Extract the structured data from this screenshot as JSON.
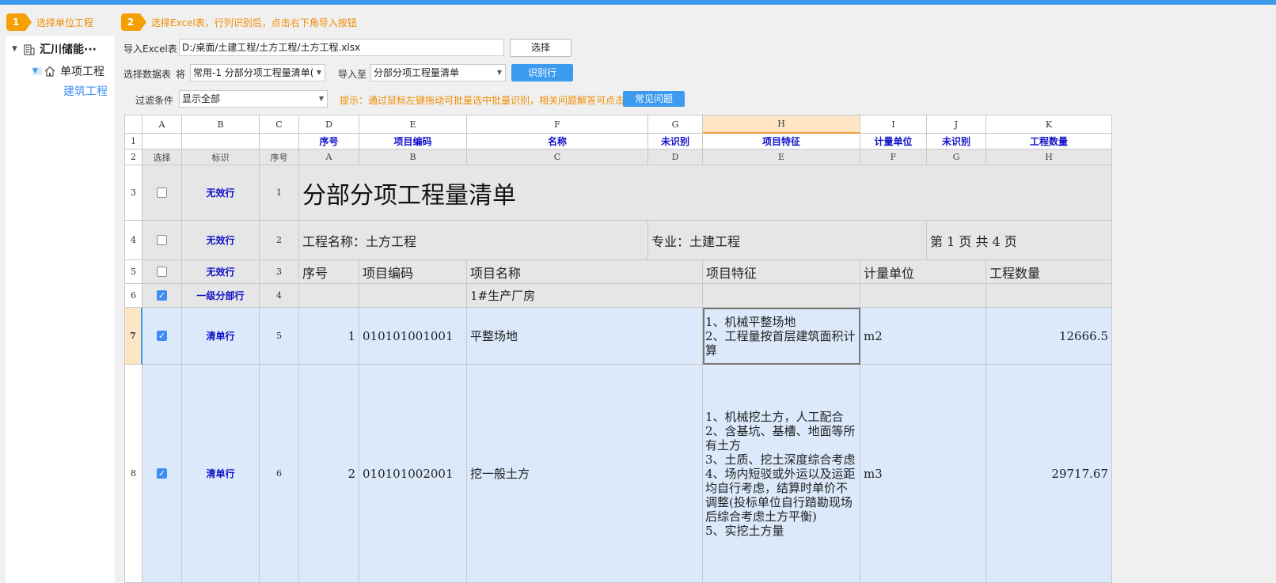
{
  "steps": [
    {
      "num": "1",
      "text": "选择单位工程"
    },
    {
      "num": "2",
      "text": "选择Excel表，行列识别后，点击右下角导入按钮"
    }
  ],
  "tree": {
    "root": "汇川储能···",
    "child": "单项工程",
    "leaf": "建筑工程"
  },
  "controls": {
    "import_label": "导入Excel表",
    "file_path": "D:/桌面/土建工程/土方工程/土方工程.xlsx",
    "choose_button": "选择",
    "sheet_label": "选择数据表",
    "sheet_prefix": "将",
    "sheet_value": "常用-1 分部分项工程量清单(",
    "import_to_label": "导入至",
    "import_to_value": "分部分项工程量清单",
    "recognize_button": "识别行",
    "filter_label": "过滤条件",
    "filter_value": "显示全部",
    "hint": "提示：通过鼠标左键拖动可批量选中批量识别，相关问题解答可点击",
    "faq_button": "常见问题"
  },
  "grid": {
    "col_letters": [
      "A",
      "B",
      "C",
      "D",
      "E",
      "F",
      "G",
      "H",
      "I",
      "J",
      "K"
    ],
    "row1": [
      "",
      "",
      "",
      "序号",
      "项目编码",
      "名称",
      "未识别",
      "项目特征",
      "计量单位",
      "未识别",
      "工程数量"
    ],
    "row2": [
      "选择",
      "标识",
      "序号",
      "A",
      "B",
      "C",
      "D",
      "E",
      "F",
      "G",
      "H"
    ],
    "rows": [
      {
        "rn": "3",
        "tag": "无效行",
        "seq": "1",
        "checked": false,
        "title": "分部分项工程量清单"
      },
      {
        "rn": "4",
        "tag": "无效行",
        "seq": "2",
        "checked": false,
        "project": "工程名称：土方工程",
        "major": "专业：土建工程",
        "page": "第 1 页  共 4 页"
      },
      {
        "rn": "5",
        "tag": "无效行",
        "seq": "3",
        "checked": false,
        "cells": [
          "序号",
          "项目编码",
          "项目名称",
          "项目特征",
          "计量单位",
          "工程数量"
        ]
      },
      {
        "rn": "6",
        "tag": "一级分部行",
        "seq": "4",
        "checked": true,
        "name": "1#生产厂房"
      },
      {
        "rn": "7",
        "tag": "清单行",
        "seq": "5",
        "checked": true,
        "no": "1",
        "code": "010101001001",
        "name": "平整场地",
        "feature": "1、机械平整场地\n2、工程量按首层建筑面积计算",
        "unit": "m2",
        "qty": "12666.5"
      },
      {
        "rn": "8",
        "tag": "清单行",
        "seq": "6",
        "checked": true,
        "no": "2",
        "code": "010101002001",
        "name": "挖一般土方",
        "feature": "1、机械挖土方，人工配合\n2、含基坑、基槽、地面等所有土方\n3、土质、挖土深度综合考虑\n4、场内短驳或外运以及运距均自行考虑，结算时单价不调整(投标单位自行踏勘现场后综合考虑土方平衡)\n5、实挖土方量",
        "unit": "m3",
        "qty": "29717.67"
      }
    ]
  }
}
